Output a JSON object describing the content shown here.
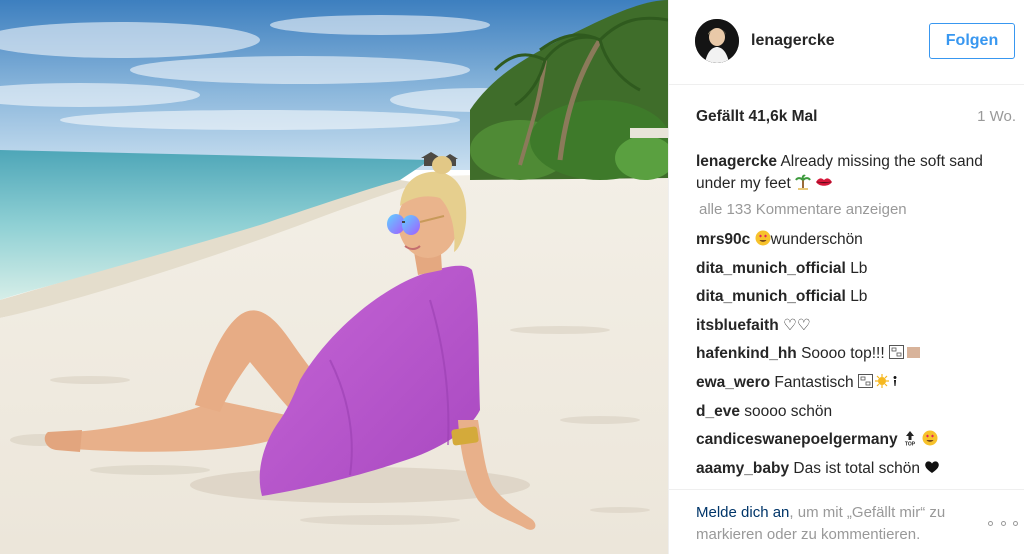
{
  "post": {
    "image_alt": "Photo by lenagercke",
    "username": "lenagercke",
    "follow_label": "Folgen",
    "likes": "Gefällt 41,6k Mal",
    "time_ago": "1 Wo.",
    "caption_user": "lenagercke",
    "caption_text": "Already missing the soft sand under my feet",
    "caption_emojis": [
      "palm-tree-emoji",
      "kiss-emoji"
    ],
    "view_all_comments": "alle 133 Kommentare anzeigen",
    "comments": [
      {
        "user": "mrs90c",
        "text": "wunderschön",
        "emoji_before": "smiling-heart-eyes-emoji"
      },
      {
        "user": "dita_munich_official",
        "text": "Lb"
      },
      {
        "user": "dita_munich_official",
        "text": "Lb"
      },
      {
        "user": "itsbluefaith",
        "text": "♡♡"
      },
      {
        "user": "hafenkind_hh",
        "text": "Soooo top!!!",
        "emoji_after": "missing-glyph-emoji"
      },
      {
        "user": "ewa_wero",
        "text": "Fantastisch",
        "emoji_after": "missing-glyph-sun-emoji"
      },
      {
        "user": "d_eve",
        "text": "soooo schön"
      },
      {
        "user": "candiceswanepoelgermany",
        "text": "",
        "emoji_after": "top-heart-eyes-emoji"
      },
      {
        "user": "aaamy_baby",
        "text": "Das ist total schön",
        "emoji_after": "black-heart-emoji"
      }
    ],
    "login_link": "Melde dich an",
    "login_rest": ", um mit „Gefällt mir“ zu markieren oder zu kommentieren.",
    "colors": {
      "link": "#3897f0",
      "dark_link": "#003569",
      "muted": "#999999",
      "text": "#262626"
    }
  }
}
